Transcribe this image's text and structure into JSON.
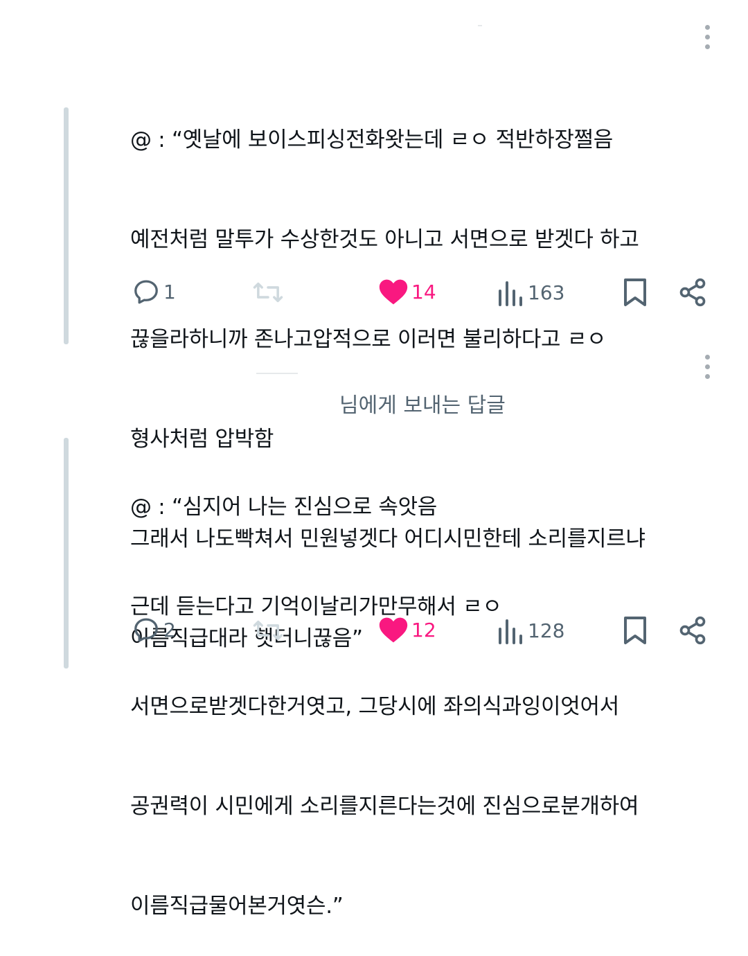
{
  "posts": [
    {
      "lines": [
        "@ : “옛날에 보이스피싱전화왓는데 ㄹㅇ 적반하장쩔음",
        "예전처럼 말투가 수상한것도 아니고 서면으로 받겟다 하고",
        "끊을라하니까 존나고압적으로 이러면 불리하다고 ㄹㅇ",
        "형사처럼 압박함",
        "그래서 나도빡쳐서 민원넣겟다 어디시민한테 소리를지르냐",
        "이름직급대라 햇더니끊음”"
      ],
      "replies": "1",
      "likes": "14",
      "views": "163"
    },
    {
      "reply_to": "님에게 보내는 답글",
      "lines": [
        "@ : “심지어 나는 진심으로 속앗음",
        "근데 듣는다고 기억이날리가만무해서 ㄹㅇ",
        "서면으로받겟다한거엿고, 그당시에 좌의식과잉이엇어서",
        "공권력이 시민에게 소리를지른다는것에 진심으로분개하여",
        "이름직급물어본거엿슨.”"
      ],
      "replies": "2",
      "likes": "12",
      "views": "128"
    }
  ],
  "icons": {
    "reply": "reply-bubble-icon",
    "repost": "repost-arrows-icon",
    "like": "heart-icon",
    "views": "views-bar-chart-icon",
    "bookmark": "bookmark-icon",
    "share": "share-icon",
    "more": "more-vertical-icon"
  },
  "colors": {
    "like_active": "#f91880",
    "muted": "#536471",
    "thread_line": "#cfd9de"
  }
}
